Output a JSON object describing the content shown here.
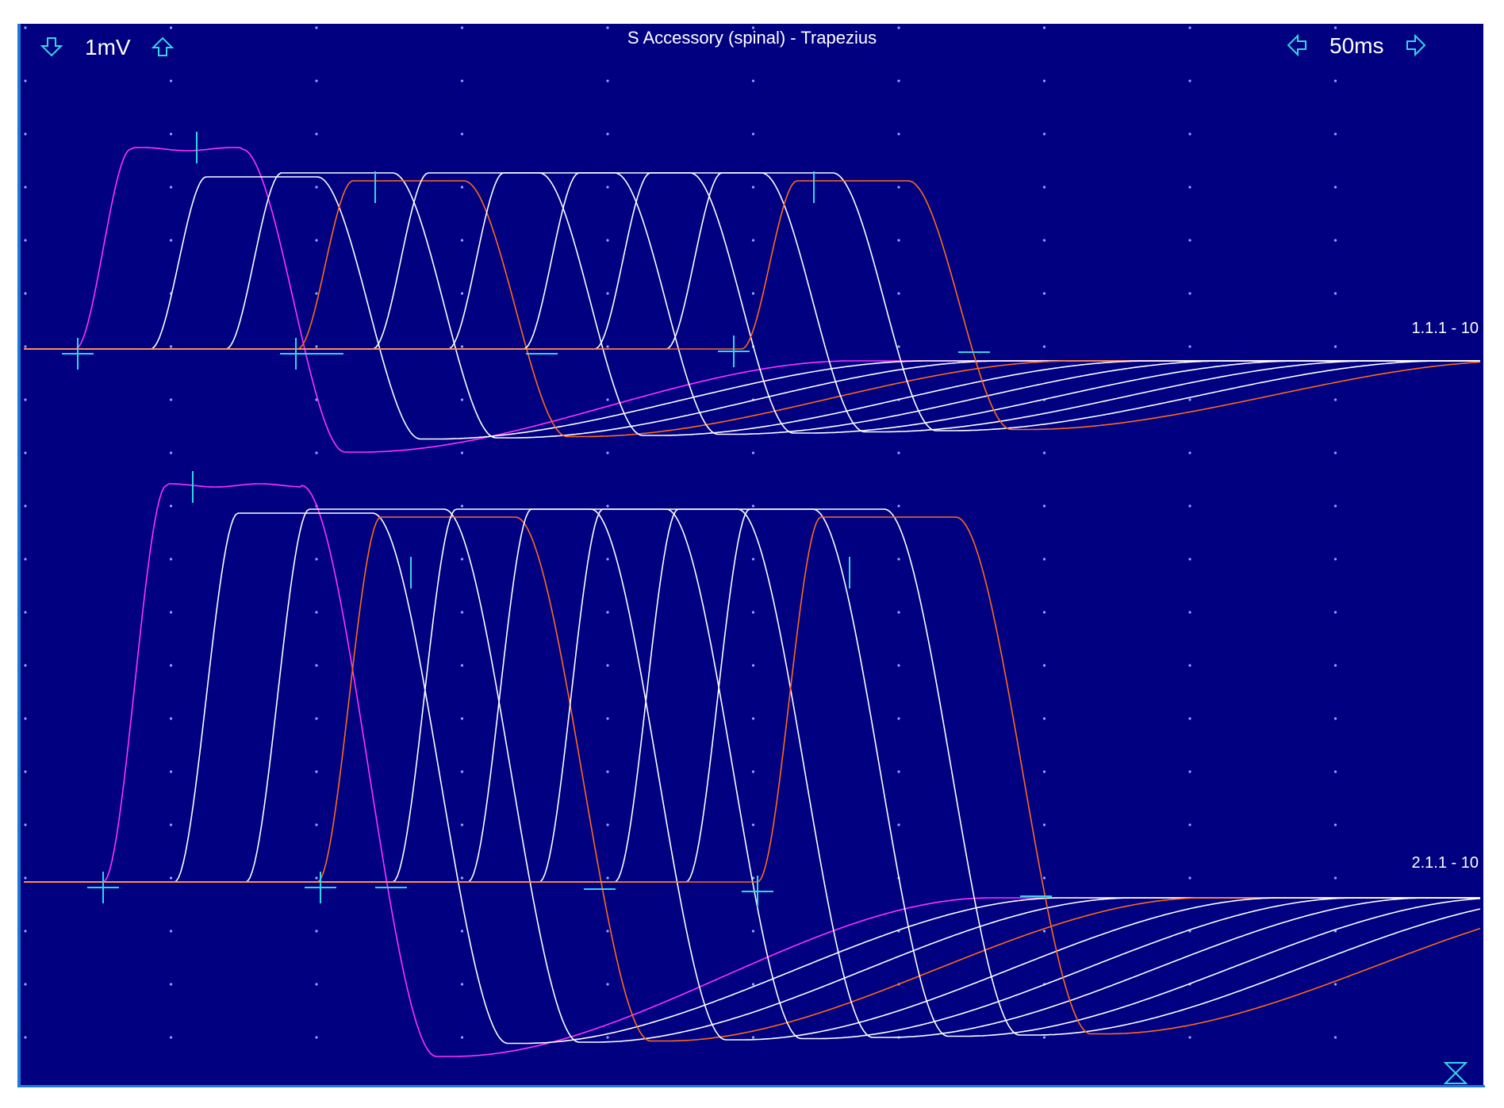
{
  "header": {
    "title": "S Accessory (spinal) - Trapezius",
    "sensitivity": "1mV",
    "sweep": "50ms"
  },
  "icons": {
    "sensitivity_down": "arrow-down-outline-icon",
    "sensitivity_up": "arrow-up-outline-icon",
    "sweep_left": "arrow-left-outline-icon",
    "sweep_right": "arrow-right-outline-icon",
    "corner": "hourglass-icon"
  },
  "channels": [
    {
      "label": "1.1.1 - 10"
    },
    {
      "label": "2.1.1 - 10"
    }
  ],
  "colors": {
    "background": "#000080",
    "trace": "#ffffff",
    "first_trace": "#ff33ff",
    "marked_trace": "#ff6a1a",
    "cursor": "#33d6e6",
    "grid_dot": "#8fa8ff",
    "border": "#1e78d8"
  },
  "chart_data": {
    "type": "line",
    "title": "S Accessory (spinal) - Trapezius",
    "xlabel": "",
    "ylabel": "",
    "traces_per_channel": 10,
    "grid": true
  }
}
